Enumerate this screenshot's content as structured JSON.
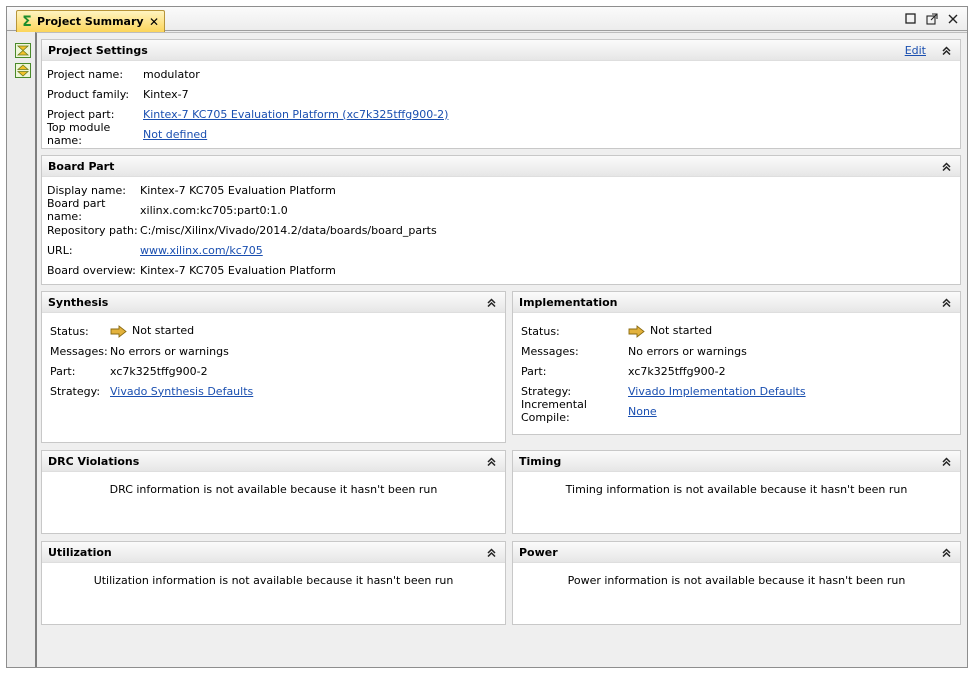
{
  "tab": {
    "title": "Project Summary",
    "close_glyph": "✕"
  },
  "window_controls": {
    "maximize": "☐",
    "popout": "⧉",
    "close": "✕"
  },
  "colors": {
    "link": "#1a4fb0",
    "tab_bg": "#fcd55a",
    "sigma": "#1d8d2d",
    "arrow": "#d4a020"
  },
  "project_settings": {
    "title": "Project Settings",
    "edit": "Edit",
    "rows": [
      {
        "label": "Project name:",
        "value": "modulator",
        "link": false
      },
      {
        "label": "Product family:",
        "value": "Kintex-7",
        "link": false
      },
      {
        "label": "Project part:",
        "value": "Kintex-7 KC705 Evaluation Platform (xc7k325tffg900-2)",
        "link": true
      },
      {
        "label": "Top module name:",
        "value": "Not defined",
        "link": true
      }
    ]
  },
  "board_part": {
    "title": "Board Part",
    "rows": [
      {
        "label": "Display name:",
        "value": "Kintex-7 KC705 Evaluation Platform",
        "link": false
      },
      {
        "label": "Board part name:",
        "value": "xilinx.com:kc705:part0:1.0",
        "link": false
      },
      {
        "label": "Repository path:",
        "value": "C:/misc/Xilinx/Vivado/2014.2/data/boards/board_parts",
        "link": false
      },
      {
        "label": "URL:",
        "value": "www.xilinx.com/kc705",
        "link": true
      },
      {
        "label": "Board overview:",
        "value": "Kintex-7 KC705 Evaluation Platform",
        "link": false
      }
    ]
  },
  "synthesis": {
    "title": "Synthesis",
    "rows": [
      {
        "label": "Status:",
        "value": "Not started",
        "link": false
      },
      {
        "label": "Messages:",
        "value": "No errors or warnings",
        "link": false
      },
      {
        "label": "Part:",
        "value": "xc7k325tffg900-2",
        "link": false
      },
      {
        "label": "Strategy:",
        "value": "Vivado Synthesis Defaults",
        "link": true
      }
    ]
  },
  "implementation": {
    "title": "Implementation",
    "rows": [
      {
        "label": "Status:",
        "value": "Not started",
        "link": false
      },
      {
        "label": "Messages:",
        "value": "No errors or warnings",
        "link": false
      },
      {
        "label": "Part:",
        "value": "xc7k325tffg900-2",
        "link": false
      },
      {
        "label": "Strategy:",
        "value": "Vivado Implementation Defaults",
        "link": true
      },
      {
        "label": "Incremental Compile:",
        "value": "None",
        "link": true
      }
    ]
  },
  "drc": {
    "title": "DRC Violations",
    "message": "DRC information is not available because it hasn't been run"
  },
  "timing": {
    "title": "Timing",
    "message": "Timing information is not available because it hasn't been run"
  },
  "utilization": {
    "title": "Utilization",
    "message": "Utilization information is not available because it hasn't been run"
  },
  "power": {
    "title": "Power",
    "message": "Power information is not available because it hasn't been run"
  }
}
